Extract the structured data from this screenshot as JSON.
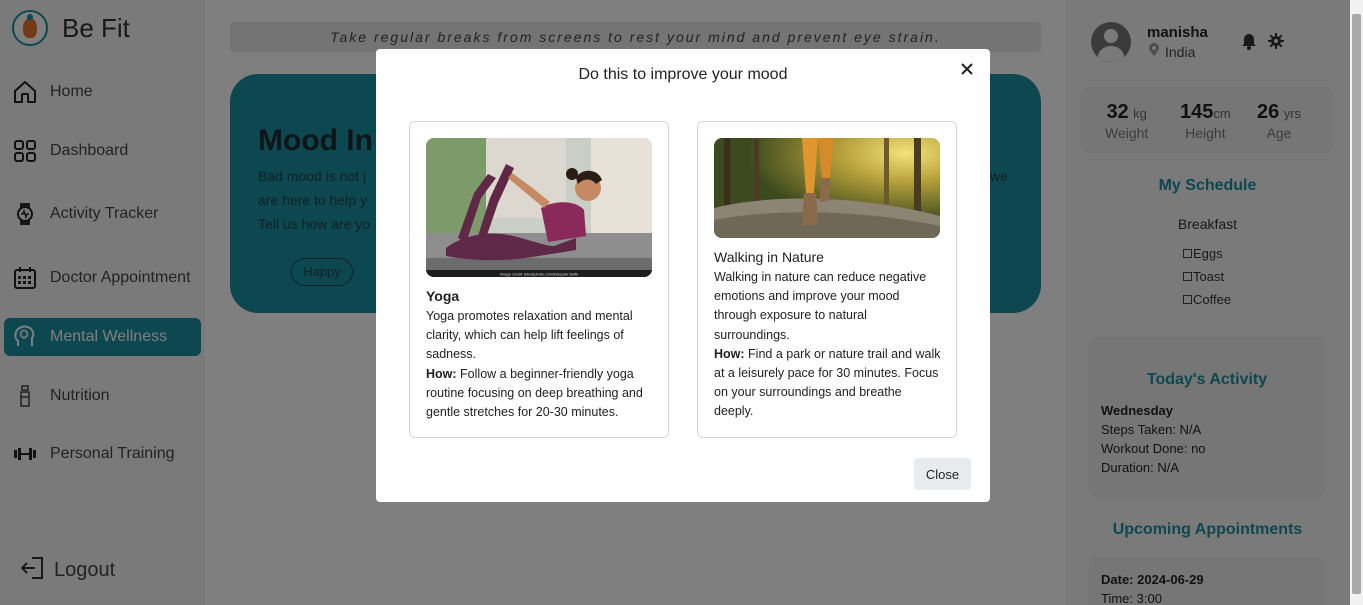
{
  "app": {
    "name": "Be Fit"
  },
  "sidebar": {
    "items": [
      {
        "label": "Home",
        "icon": "home-icon"
      },
      {
        "label": "Dashboard",
        "icon": "dashboard-icon"
      },
      {
        "label": "Activity Tracker",
        "icon": "watch-icon"
      },
      {
        "label": "Doctor Appointment",
        "icon": "calendar-icon"
      },
      {
        "label": "Mental Wellness",
        "icon": "head-bulb-icon",
        "active": true
      },
      {
        "label": "Nutrition",
        "icon": "bottle-icon"
      },
      {
        "label": "Personal Training",
        "icon": "dumbbell-icon"
      }
    ],
    "logout_label": "Logout"
  },
  "main": {
    "tip": "Take regular breaks from screens to rest your mind and prevent eye strain.",
    "mood": {
      "title": "Mood In",
      "line1": "Bad mood is not j",
      "line1_tail": "we",
      "line2": "are here to help y",
      "line3": "Tell us how are yo",
      "happy_button": "Happy"
    }
  },
  "profile": {
    "name": "manisha",
    "location": "India",
    "weight": {
      "value": "32",
      "unit": "kg",
      "label": "Weight"
    },
    "height": {
      "value": "145",
      "unit": "cm",
      "label": "Height"
    },
    "age": {
      "value": "26",
      "unit": "yrs",
      "label": "Age"
    }
  },
  "schedule": {
    "title": "My Schedule",
    "meal": "Breakfast",
    "items": [
      "Eggs",
      "Toast",
      "Coffee"
    ]
  },
  "activity": {
    "title": "Today's Activity",
    "day": "Wednesday",
    "steps": "Steps Taken: N/A",
    "workout": "Workout Done: no",
    "duration": "Duration: N/A"
  },
  "appointments": {
    "title": "Upcoming Appointments",
    "date": "Date: 2024-06-29",
    "time": "Time: 3:00"
  },
  "modal": {
    "title": "Do this to improve your mood",
    "close_label": "Close",
    "cards": [
      {
        "name": "Yoga",
        "image_credit": "Image credit: istockphoto.com/Deepak Sethi",
        "desc": "Yoga promotes relaxation and mental clarity, which can help lift feelings of sadness.",
        "how_label": "How:",
        "how": "Follow a beginner-friendly yoga routine focusing on deep breathing and gentle stretches for 20-30 minutes."
      },
      {
        "name": "Walking in Nature",
        "desc": "Walking in nature can reduce negative emotions and improve your mood through exposure to natural surroundings.",
        "how_label": "How:",
        "how": "Find a park or nature trail and walk at a leisurely pace for 30 minutes. Focus on your surroundings and breathe deeply."
      }
    ]
  },
  "colors": {
    "accent": "#1a8fa0",
    "overlay": "rgba(0,0,0,0.5)"
  }
}
